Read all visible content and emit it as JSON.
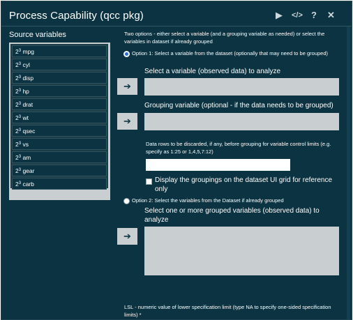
{
  "window": {
    "title": "Process Capability (qcc pkg)",
    "icons": [
      "play-icon",
      "code-icon",
      "help-icon",
      "close-icon"
    ],
    "icon_glyphs": {
      "play": "▶",
      "code": "</>",
      "help": "?",
      "close": "✕"
    }
  },
  "source_panel": {
    "label": "Source variables",
    "items": [
      {
        "prefix": "2",
        "label": "mpg"
      },
      {
        "prefix": "2",
        "label": "cyl"
      },
      {
        "prefix": "2",
        "label": "disp"
      },
      {
        "prefix": "2",
        "label": "hp"
      },
      {
        "prefix": "2",
        "label": "drat"
      },
      {
        "prefix": "2",
        "label": "wt"
      },
      {
        "prefix": "2",
        "label": "qsec"
      },
      {
        "prefix": "2",
        "label": "vs"
      },
      {
        "prefix": "2",
        "label": "am"
      },
      {
        "prefix": "2",
        "label": "gear"
      },
      {
        "prefix": "2",
        "label": "carb"
      }
    ],
    "item_sup": "3"
  },
  "options": {
    "intro": "Two options - either select a variable (and a grouping variable as needed) or select the variables in dataset if already grouped",
    "option1_label": "Option 1: Select a variable from the dataset (optionally that may need to be grouped)",
    "option1_selected": true,
    "select_variable_label": "Select a variable (observed data) to analyze",
    "grouping_label": "Grouping variable (optional - if the data needs to be grouped)",
    "discard_label": "Data rows to be discarded, if any, before grouping for variable control limits (e.g. specify as 1:25 or 1,4,5,7:12)",
    "discard_value": "",
    "display_groupings_label": "Display the groupings on the dataset UI grid for reference only",
    "display_groupings_checked": false,
    "option2_label": "Option 2: Select the variables from the Dataset if already grouped",
    "option2_selected": false,
    "grouped_vars_label": "Select one or more grouped variables (observed data) to analyze",
    "lsl_label": "LSL - numeric value of lower specification limit (type NA to specify one-sided specification limits) *"
  },
  "buttons": {
    "move_glyph": "➔"
  },
  "colors": {
    "background": "#0c3341",
    "panel": "#c9cfd1",
    "accent": "#2a6fdb"
  }
}
